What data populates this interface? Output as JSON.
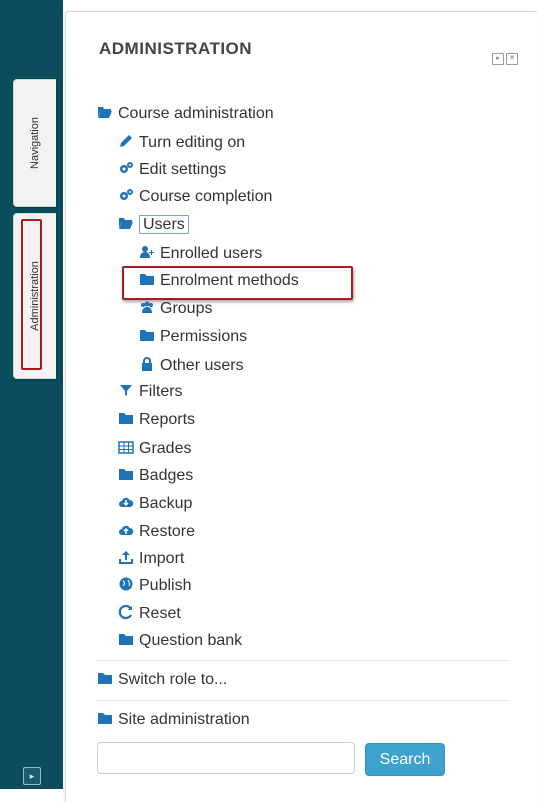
{
  "dock": {
    "navigation_tab": "Navigation",
    "administration_tab": "Administration"
  },
  "block": {
    "title": "ADMINISTRATION",
    "dock_icon": "dock-icon",
    "close_icon": "close-icon"
  },
  "tree": {
    "course_admin": {
      "label": "Course administration",
      "icon": "folder-open-icon"
    },
    "turn_editing": {
      "label": "Turn editing on",
      "icon": "pencil-icon"
    },
    "edit_settings": {
      "label": "Edit settings",
      "icon": "gears-icon"
    },
    "course_completion": {
      "label": "Course completion",
      "icon": "gears-icon"
    },
    "users": {
      "label": "Users",
      "icon": "folder-open-icon"
    },
    "enrolled_users": {
      "label": "Enrolled users",
      "icon": "user-plus-icon"
    },
    "enrolment_methods": {
      "label": "Enrolment methods",
      "icon": "folder-icon"
    },
    "groups": {
      "label": "Groups",
      "icon": "users-icon"
    },
    "permissions": {
      "label": "Permissions",
      "icon": "folder-icon"
    },
    "other_users": {
      "label": "Other users",
      "icon": "lock-icon"
    },
    "filters": {
      "label": "Filters",
      "icon": "filter-icon"
    },
    "reports": {
      "label": "Reports",
      "icon": "folder-icon"
    },
    "grades": {
      "label": "Grades",
      "icon": "table-icon"
    },
    "badges": {
      "label": "Badges",
      "icon": "folder-icon"
    },
    "backup": {
      "label": "Backup",
      "icon": "cloud-download-icon"
    },
    "restore": {
      "label": "Restore",
      "icon": "cloud-upload-icon"
    },
    "import": {
      "label": "Import",
      "icon": "upload-icon"
    },
    "publish": {
      "label": "Publish",
      "icon": "globe-icon"
    },
    "reset": {
      "label": "Reset",
      "icon": "refresh-icon"
    },
    "question_bank": {
      "label": "Question bank",
      "icon": "folder-icon"
    },
    "switch_role": {
      "label": "Switch role to...",
      "icon": "folder-icon"
    },
    "site_admin": {
      "label": "Site administration",
      "icon": "folder-icon"
    }
  },
  "search": {
    "value": "",
    "button_label": "Search"
  },
  "colors": {
    "dock_bg": "#0b4d5d",
    "icon_blue": "#1f73b7",
    "highlight_red": "#a31d23",
    "search_button": "#3ea2cf"
  }
}
